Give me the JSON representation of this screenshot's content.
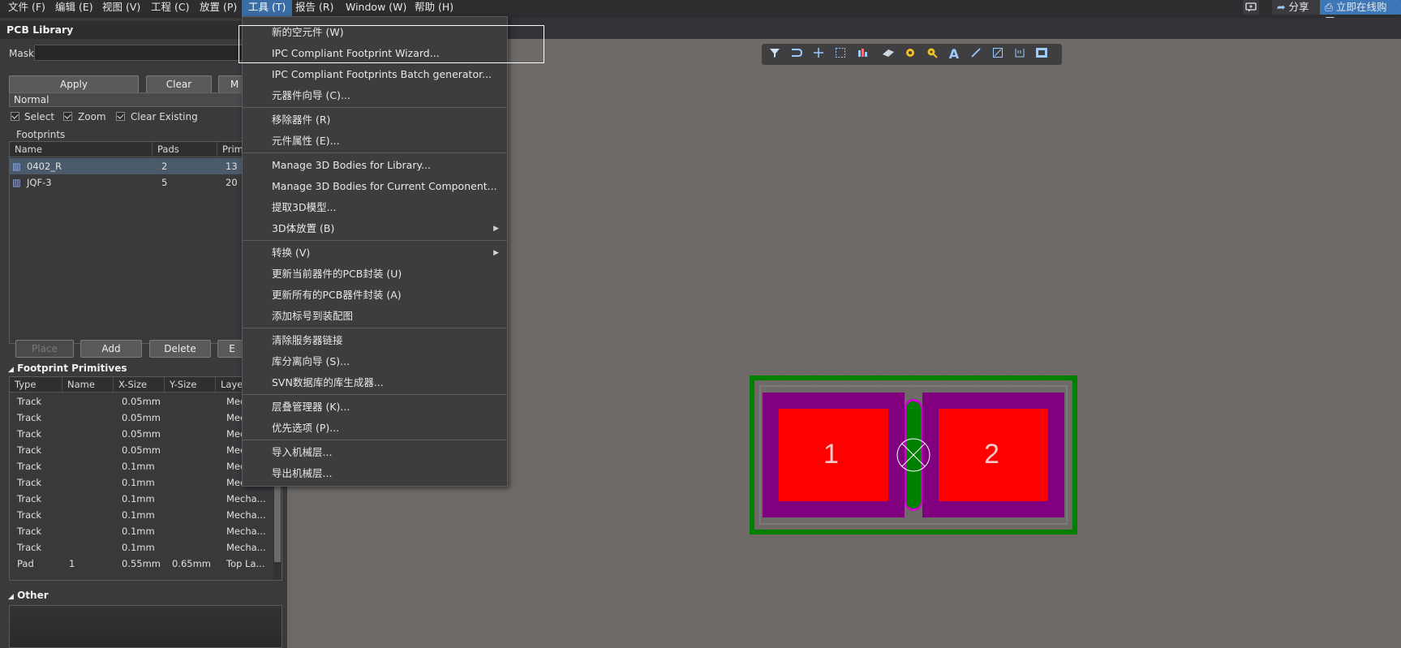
{
  "menubar": {
    "items": [
      "文件 (F)",
      "编辑 (E)",
      "视图 (V)",
      "工程 (C)",
      "放置 (P)",
      "工具 (T)",
      "报告 (R)",
      "Window (W)",
      "帮助 (H)"
    ],
    "right": {
      "chat_icon": "chat-icon",
      "share": "分享",
      "buy": "立即在线购买"
    }
  },
  "panel": {
    "title": "PCB Library",
    "mask_label": "Mask",
    "buttons": {
      "apply": "Apply",
      "clear": "Clear",
      "magnify": "M"
    },
    "mode": "Normal",
    "checks": {
      "select": "Select",
      "zoom": "Zoom",
      "clear_existing": "Clear Existing"
    },
    "footprints_label": "Footprints",
    "footprint_columns": [
      "Name",
      "Pads",
      "Primi"
    ],
    "footprints": [
      {
        "name": "0402_R",
        "pads": "2",
        "primitives": "13"
      },
      {
        "name": "JQF-3",
        "pads": "5",
        "primitives": "20"
      }
    ],
    "actions": {
      "place": "Place",
      "add": "Add",
      "delete": "Delete",
      "edit": "E"
    },
    "primitives_label": "Footprint Primitives",
    "primitive_columns": [
      "Type",
      "Name",
      "X-Size",
      "Y-Size",
      "Laye"
    ],
    "primitives": [
      {
        "type": "Track",
        "name": "",
        "xsize": "0.05mm",
        "ysize": "",
        "layer": "Mec"
      },
      {
        "type": "Track",
        "name": "",
        "xsize": "0.05mm",
        "ysize": "",
        "layer": "Mec"
      },
      {
        "type": "Track",
        "name": "",
        "xsize": "0.05mm",
        "ysize": "",
        "layer": "Mec"
      },
      {
        "type": "Track",
        "name": "",
        "xsize": "0.05mm",
        "ysize": "",
        "layer": "Mec"
      },
      {
        "type": "Track",
        "name": "",
        "xsize": "0.1mm",
        "ysize": "",
        "layer": "Mec"
      },
      {
        "type": "Track",
        "name": "",
        "xsize": "0.1mm",
        "ysize": "",
        "layer": "Mec"
      },
      {
        "type": "Track",
        "name": "",
        "xsize": "0.1mm",
        "ysize": "",
        "layer": "Mecha..."
      },
      {
        "type": "Track",
        "name": "",
        "xsize": "0.1mm",
        "ysize": "",
        "layer": "Mecha..."
      },
      {
        "type": "Track",
        "name": "",
        "xsize": "0.1mm",
        "ysize": "",
        "layer": "Mecha..."
      },
      {
        "type": "Track",
        "name": "",
        "xsize": "0.1mm",
        "ysize": "",
        "layer": "Mecha..."
      },
      {
        "type": "Pad",
        "name": "1",
        "xsize": "0.55mm",
        "ysize": "0.65mm",
        "layer": "Top La..."
      }
    ],
    "other_label": "Other"
  },
  "dropdown": {
    "items": [
      {
        "label": "新的空元件 (W)",
        "submenu": false
      },
      {
        "label": "IPC Compliant Footprint Wizard...",
        "submenu": false
      },
      {
        "label": "IPC Compliant Footprints Batch generator...",
        "submenu": false
      },
      {
        "label": "元器件向导 (C)...",
        "submenu": false
      },
      {
        "label": "移除器件 (R)",
        "submenu": false
      },
      {
        "label": "元件属性 (E)...",
        "submenu": false
      },
      {
        "label": "Manage 3D Bodies for Library...",
        "submenu": false
      },
      {
        "label": "Manage 3D Bodies for Current Component...",
        "submenu": false
      },
      {
        "label": "提取3D模型...",
        "submenu": false
      },
      {
        "label": "3D体放置 (B)",
        "submenu": true
      },
      {
        "label": "转换 (V)",
        "submenu": true
      },
      {
        "label": "更新当前器件的PCB封装 (U)",
        "submenu": false
      },
      {
        "label": "更新所有的PCB器件封装 (A)",
        "submenu": false
      },
      {
        "label": "添加标号到装配图",
        "submenu": false
      },
      {
        "label": "清除服务器链接",
        "submenu": false
      },
      {
        "label": "库分离向导 (S)...",
        "submenu": false
      },
      {
        "label": "SVN数据库的库生成器...",
        "submenu": false
      },
      {
        "label": "层叠管理器 (K)...",
        "submenu": false
      },
      {
        "label": "优先选项 (P)...",
        "submenu": false
      },
      {
        "label": "导入机械层...",
        "submenu": false
      },
      {
        "label": "导出机械层...",
        "submenu": false
      }
    ]
  },
  "canvas": {
    "pads": [
      "1",
      "2"
    ],
    "colors": {
      "background": "#6d6a68",
      "courtyard": "#008000",
      "pad": "#ff0000",
      "mask": "#800080",
      "silk": "#008000"
    }
  },
  "toolbar_icons": [
    "filter-icon",
    "route-icon",
    "cross-icon",
    "select-rect-icon",
    "align-icon",
    "component-icon",
    "pad-icon",
    "via-icon",
    "text-icon",
    "line-icon",
    "dimension-icon",
    "measure-icon",
    "region-icon"
  ]
}
